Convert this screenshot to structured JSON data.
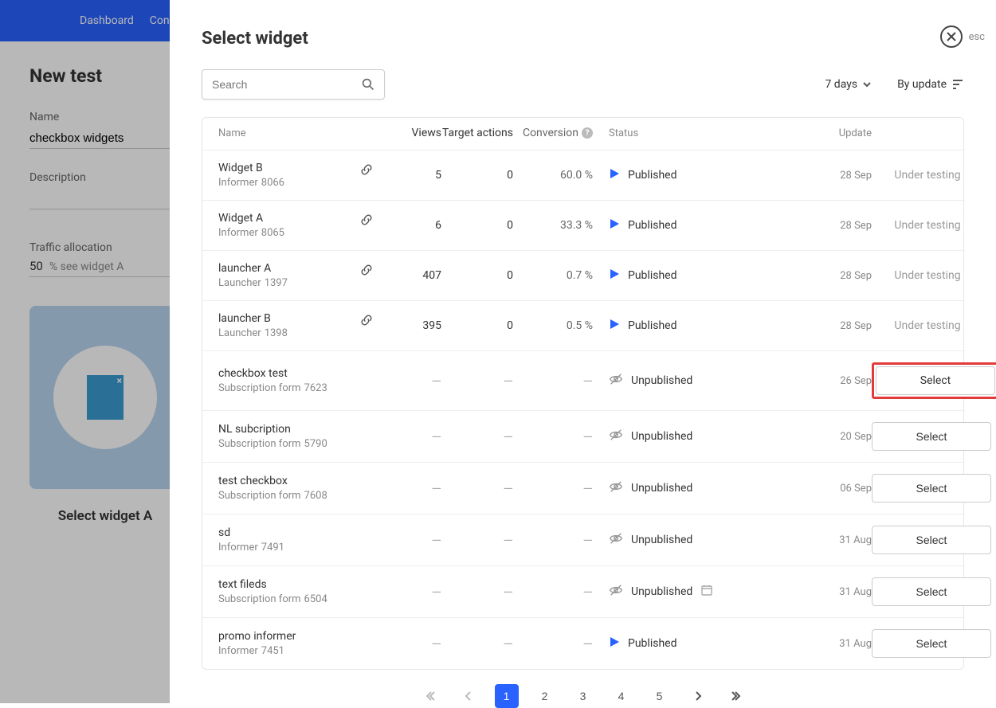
{
  "bg": {
    "nav": {
      "dashboard": "Dashboard",
      "con": "Con"
    },
    "title": "New test",
    "name_label": "Name",
    "name_value": "checkbox widgets",
    "desc_label": "Description",
    "traffic_label": "Traffic allocation",
    "traffic_value": "50",
    "traffic_suffix": "% see widget A",
    "select_widget_label": "Select widget A"
  },
  "modal": {
    "title": "Select widget",
    "esc": "esc",
    "search_placeholder": "Search",
    "period": "7 days",
    "sort": "By update",
    "columns": {
      "name": "Name",
      "views": "Views",
      "target": "Target actions",
      "conv": "Conversion",
      "status": "Status",
      "update": "Update"
    },
    "status_published": "Published",
    "status_unpublished": "Unpublished",
    "under_testing": "Under testing",
    "select_label": "Select",
    "rows": [
      {
        "name": "Widget B",
        "type": "Informer",
        "code": "8066",
        "link": true,
        "views": "5",
        "target": "0",
        "conv": "60.0 %",
        "status": "published",
        "date": "28 Sep",
        "action": "testing"
      },
      {
        "name": "Widget A",
        "type": "Informer",
        "code": "8065",
        "link": true,
        "views": "6",
        "target": "0",
        "conv": "33.3 %",
        "status": "published",
        "date": "28 Sep",
        "action": "testing"
      },
      {
        "name": "launcher A",
        "type": "Launcher",
        "code": "1397",
        "link": true,
        "views": "407",
        "target": "0",
        "conv": "0.7 %",
        "status": "published",
        "date": "28 Sep",
        "action": "testing"
      },
      {
        "name": "launcher B",
        "type": "Launcher",
        "code": "1398",
        "link": true,
        "views": "395",
        "target": "0",
        "conv": "0.5 %",
        "status": "published",
        "date": "28 Sep",
        "action": "testing"
      },
      {
        "name": "checkbox test",
        "type": "Subscription form",
        "code": "7623",
        "link": false,
        "views": "—",
        "target": "—",
        "conv": "—",
        "status": "unpublished",
        "date": "26 Sep",
        "action": "select",
        "highlight": true
      },
      {
        "name": "NL subcription",
        "type": "Subscription form",
        "code": "5790",
        "link": false,
        "views": "—",
        "target": "—",
        "conv": "—",
        "status": "unpublished",
        "date": "20 Sep",
        "action": "select"
      },
      {
        "name": "test checkbox",
        "type": "Subscription form",
        "code": "7608",
        "link": false,
        "views": "—",
        "target": "—",
        "conv": "—",
        "status": "unpublished",
        "date": "06 Sep",
        "action": "select"
      },
      {
        "name": "sd",
        "type": "Informer",
        "code": "7491",
        "link": false,
        "views": "—",
        "target": "—",
        "conv": "—",
        "status": "unpublished",
        "date": "31 Aug",
        "action": "select"
      },
      {
        "name": "text fileds",
        "type": "Subscription form",
        "code": "6504",
        "link": false,
        "views": "—",
        "target": "—",
        "conv": "—",
        "status": "unpublished",
        "date": "31 Aug",
        "action": "select",
        "calendar": true
      },
      {
        "name": "promo informer",
        "type": "Informer",
        "code": "7451",
        "link": false,
        "views": "—",
        "target": "—",
        "conv": "—",
        "status": "published",
        "date": "31 Aug",
        "action": "select"
      }
    ],
    "pages": [
      "1",
      "2",
      "3",
      "4",
      "5"
    ],
    "active_page": "1"
  }
}
